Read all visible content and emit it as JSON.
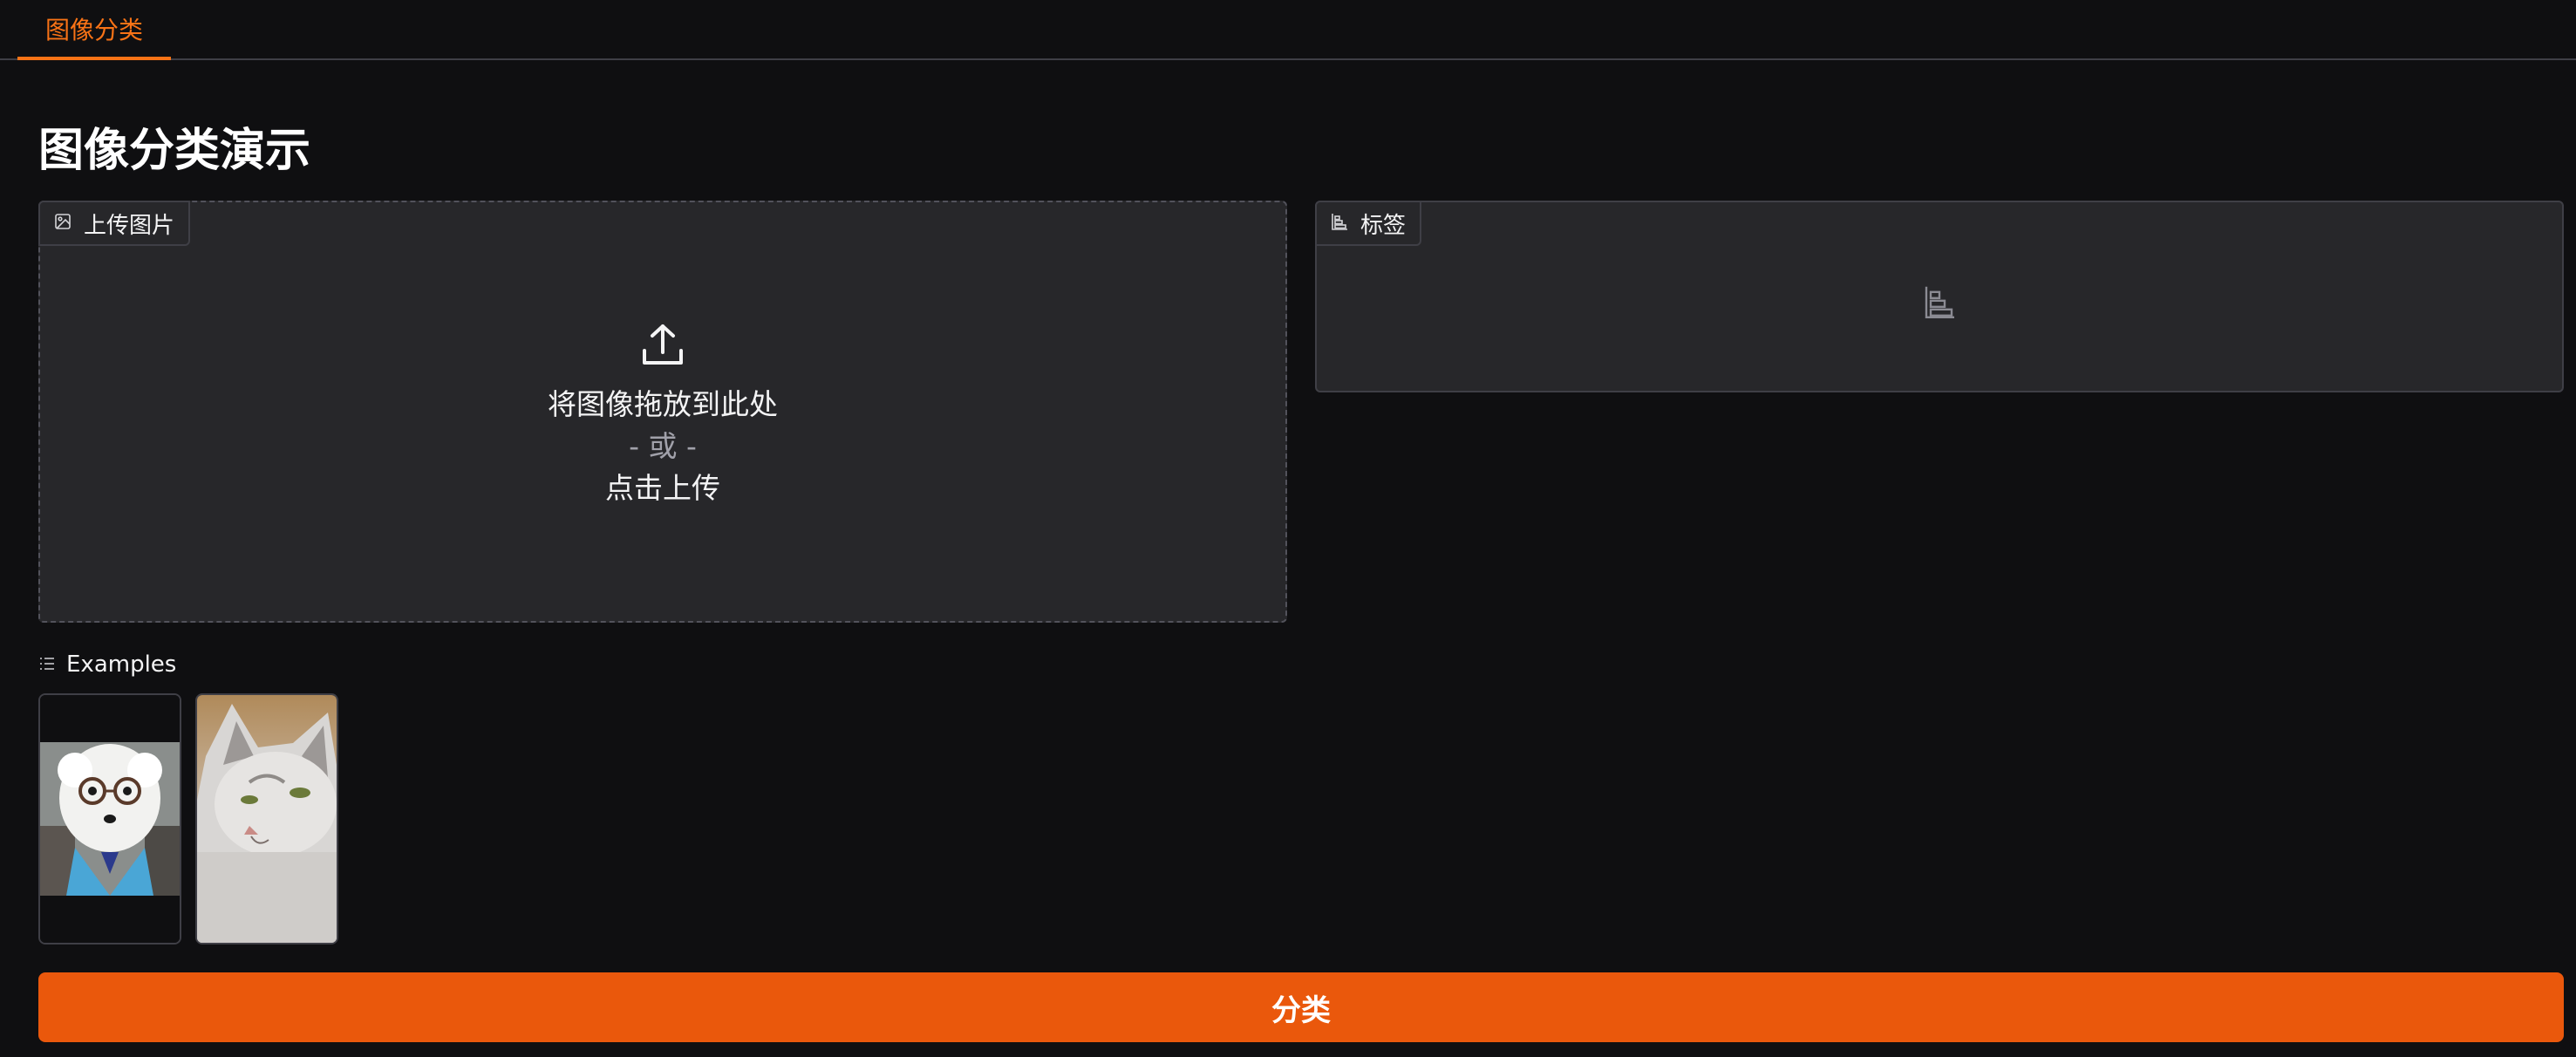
{
  "tabs": [
    {
      "label": "图像分类",
      "active": true
    }
  ],
  "page": {
    "title": "图像分类演示"
  },
  "upload": {
    "label": "上传图片",
    "icon": "image-icon",
    "upload_icon": "upload-icon",
    "drop_text": "将图像拖放到此处",
    "or_text": "- 或 -",
    "click_text": "点击上传"
  },
  "output": {
    "label": "标签",
    "icon": "bar-chart-icon",
    "empty_icon": "bar-chart-icon"
  },
  "examples": {
    "title": "Examples",
    "icon": "list-icon",
    "items": [
      {
        "name": "example-dog-with-glasses"
      },
      {
        "name": "example-grey-cat"
      }
    ]
  },
  "actions": {
    "classify_label": "分类"
  },
  "colors": {
    "accent": "#ea580c",
    "tab_active": "#f97316",
    "background": "#0f0f11",
    "panel": "#27272a"
  }
}
